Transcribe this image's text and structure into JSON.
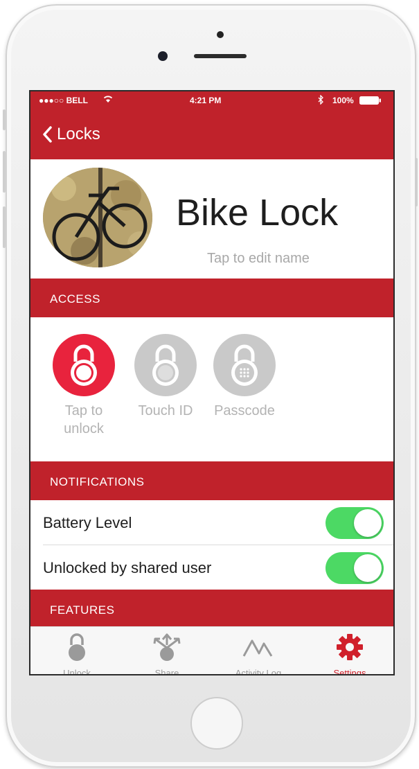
{
  "status_bar": {
    "carrier": "●●●○○ BELL",
    "time": "4:21 PM",
    "battery": "100%"
  },
  "nav": {
    "back_label": "Locks"
  },
  "lock": {
    "name": "Bike Lock",
    "edit_hint": "Tap to edit name"
  },
  "sections": {
    "access": "ACCESS",
    "notifications": "NOTIFICATIONS",
    "features": "FEATURES"
  },
  "access_options": [
    {
      "label": "Tap to unlock",
      "active": true,
      "icon": "padlock-icon"
    },
    {
      "label": "Touch ID",
      "active": false,
      "icon": "fingerprint-lock-icon"
    },
    {
      "label": "Passcode",
      "active": false,
      "icon": "keypad-lock-icon"
    }
  ],
  "notifications": [
    {
      "label": "Battery Level",
      "enabled": true
    },
    {
      "label": "Unlocked by shared user",
      "enabled": true
    }
  ],
  "tabs": [
    {
      "label": "Unlock",
      "icon": "padlock-icon",
      "active": false
    },
    {
      "label": "Share",
      "icon": "share-icon",
      "active": false
    },
    {
      "label": "Activity Log",
      "icon": "activity-icon",
      "active": false
    },
    {
      "label": "Settings",
      "icon": "gear-icon",
      "active": true
    }
  ],
  "colors": {
    "brand": "#c0222b",
    "toggle_on": "#4cd964",
    "inactive": "#b3b3b3"
  }
}
